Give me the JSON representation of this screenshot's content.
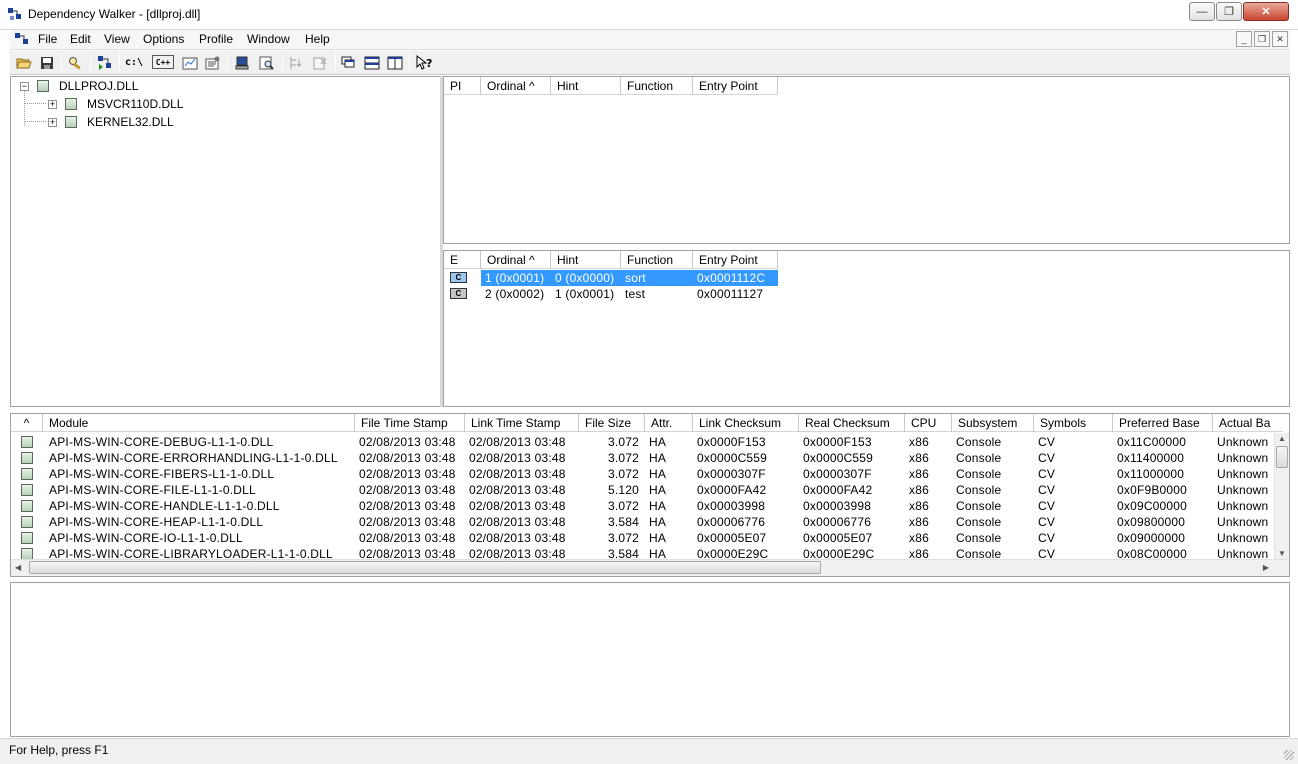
{
  "window": {
    "title": "Dependency Walker - [dllproj.dll]"
  },
  "menu": [
    "File",
    "Edit",
    "View",
    "Options",
    "Profile",
    "Window",
    "Help"
  ],
  "toolbar": {
    "tools": [
      "open-icon",
      "save-icon",
      "find-icon",
      "profile-icon",
      "full-paths-icon",
      "undecorate-cpp-icon",
      "module-order-icon",
      "properties-icon",
      "configure-icon",
      "autoexpand-icon",
      "expand-all-icon",
      "collapse-all-icon",
      "cascade-icon",
      "tile-horizontal-icon",
      "tile-vertical-icon",
      "whats-this-icon"
    ],
    "full_paths_label": "c:\\",
    "cpp_label": "C++"
  },
  "tree": {
    "root": "DLLPROJ.DLL",
    "children": [
      "MSVCR110D.DLL",
      "KERNEL32.DLL"
    ]
  },
  "imports": {
    "columns": [
      "PI",
      "Ordinal ^",
      "Hint",
      "Function",
      "Entry Point"
    ]
  },
  "exports": {
    "columns": [
      "E",
      "Ordinal ^",
      "Hint",
      "Function",
      "Entry Point"
    ],
    "rows": [
      {
        "badge": "C",
        "ordinal": "1 (0x0001)",
        "hint": "0 (0x0000)",
        "function": "sort",
        "entry": "0x0001112C"
      },
      {
        "badge": "C",
        "ordinal": "2 (0x0002)",
        "hint": "1 (0x0001)",
        "function": "test",
        "entry": "0x00011127"
      }
    ]
  },
  "modules": {
    "columns": [
      "^",
      "Module",
      "File Time Stamp",
      "Link Time Stamp",
      "File Size",
      "Attr.",
      "Link Checksum",
      "Real Checksum",
      "CPU",
      "Subsystem",
      "Symbols",
      "Preferred Base",
      "Actual Ba"
    ],
    "rows": [
      [
        "API-MS-WIN-CORE-DEBUG-L1-1-0.DLL",
        "02/08/2013 03:48",
        "02/08/2013 03:48",
        "3.072",
        "HA",
        "0x0000F153",
        "0x0000F153",
        "x86",
        "Console",
        "CV",
        "0x11C00000",
        "Unknown"
      ],
      [
        "API-MS-WIN-CORE-ERRORHANDLING-L1-1-0.DLL",
        "02/08/2013 03:48",
        "02/08/2013 03:48",
        "3.072",
        "HA",
        "0x0000C559",
        "0x0000C559",
        "x86",
        "Console",
        "CV",
        "0x11400000",
        "Unknown"
      ],
      [
        "API-MS-WIN-CORE-FIBERS-L1-1-0.DLL",
        "02/08/2013 03:48",
        "02/08/2013 03:48",
        "3.072",
        "HA",
        "0x0000307F",
        "0x0000307F",
        "x86",
        "Console",
        "CV",
        "0x11000000",
        "Unknown"
      ],
      [
        "API-MS-WIN-CORE-FILE-L1-1-0.DLL",
        "02/08/2013 03:48",
        "02/08/2013 03:48",
        "5.120",
        "HA",
        "0x0000FA42",
        "0x0000FA42",
        "x86",
        "Console",
        "CV",
        "0x0F9B0000",
        "Unknown"
      ],
      [
        "API-MS-WIN-CORE-HANDLE-L1-1-0.DLL",
        "02/08/2013 03:48",
        "02/08/2013 03:48",
        "3.072",
        "HA",
        "0x00003998",
        "0x00003998",
        "x86",
        "Console",
        "CV",
        "0x09C00000",
        "Unknown"
      ],
      [
        "API-MS-WIN-CORE-HEAP-L1-1-0.DLL",
        "02/08/2013 03:48",
        "02/08/2013 03:48",
        "3.584",
        "HA",
        "0x00006776",
        "0x00006776",
        "x86",
        "Console",
        "CV",
        "0x09800000",
        "Unknown"
      ],
      [
        "API-MS-WIN-CORE-IO-L1-1-0.DLL",
        "02/08/2013 03:48",
        "02/08/2013 03:48",
        "3.072",
        "HA",
        "0x00005E07",
        "0x00005E07",
        "x86",
        "Console",
        "CV",
        "0x09000000",
        "Unknown"
      ],
      [
        "API-MS-WIN-CORE-LIBRARYLOADER-L1-1-0.DLL",
        "02/08/2013 03:48",
        "02/08/2013 03:48",
        "3.584",
        "HA",
        "0x0000E29C",
        "0x0000E29C",
        "x86",
        "Console",
        "CV",
        "0x08C00000",
        "Unknown"
      ]
    ]
  },
  "status": {
    "text": "For Help, press F1"
  },
  "colors": {
    "selection": "#3399ff",
    "close_button": "#c7452f"
  }
}
